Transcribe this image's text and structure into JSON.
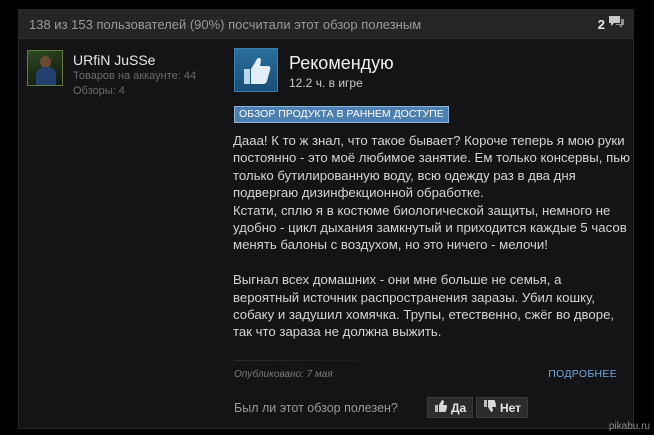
{
  "header": {
    "helpful_summary": "138 из 153 пользователей (90%) посчитали этот обзор полезным",
    "comment_count": "2"
  },
  "author": {
    "name": "URfiN JuSSe",
    "products": "Товаров на аккаунте: 44",
    "reviews": "Обзоры: 4"
  },
  "review": {
    "verdict": "Рекомендую",
    "hours": "12.2 ч. в игре",
    "early_access_badge": "ОБЗОР ПРОДУКТА В РАННЕМ ДОСТУПЕ",
    "lines": [
      "Дааа! К то ж знал, что такое бывает? Короче теперь я мою руки",
      "постоянно - это моё любимое занятие. Ем только консервы, пью",
      "только бутилированную воду, всю одежду раз в два дня",
      "подвергаю дизинфекционной обработке.",
      "Кстати, сплю я в костюме биологической защиты, немного не",
      "удобно - цикл дыхания замкнутый и приходится каждые 5 часов",
      "менять балоны с воздухом, но это ничего - мелочи!",
      "",
      "Выгнал всех домашних - они мне больше не семья, а",
      "вероятный источник распространения заразы. Убил кошку,",
      "собаку и задушил хомячка. Трупы, етественно, сжёг во дворе,",
      "так что зараза не должна выжить."
    ],
    "posted": "Опубликовано: 7 мая",
    "more_link": "ПОДРОБНЕЕ"
  },
  "vote": {
    "question": "Был ли этот обзор полезен?",
    "yes": "Да",
    "no": "Нет"
  },
  "watermark": "pikabu.ru",
  "colors": {
    "accent_blue": "#4d7fb0",
    "link": "#6fa8dc",
    "background": "#141416"
  }
}
